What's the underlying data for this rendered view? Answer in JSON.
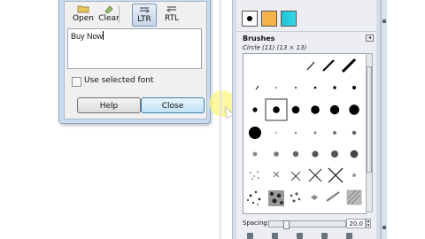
{
  "text_dialog": {
    "toolbar": {
      "open_label": "Open",
      "clear_label": "Clear",
      "ltr_label": "LTR",
      "rtl_label": "RTL"
    },
    "editor_text": "Buy Now",
    "use_selected_font_label": "Use selected font",
    "use_selected_font_checked": false,
    "help_label": "Help",
    "close_label": "Close"
  },
  "brushes_panel": {
    "swatch_colors": {
      "pattern": "#f7b34a",
      "gradient": "#1ac3d8"
    },
    "title": "Brushes",
    "brush_info": "Circle (11) (13 × 13)",
    "selected_brush": "Circle (11)",
    "spacing_label": "Spacing:",
    "spacing_value": "20.0",
    "spacing_percent": 20
  }
}
